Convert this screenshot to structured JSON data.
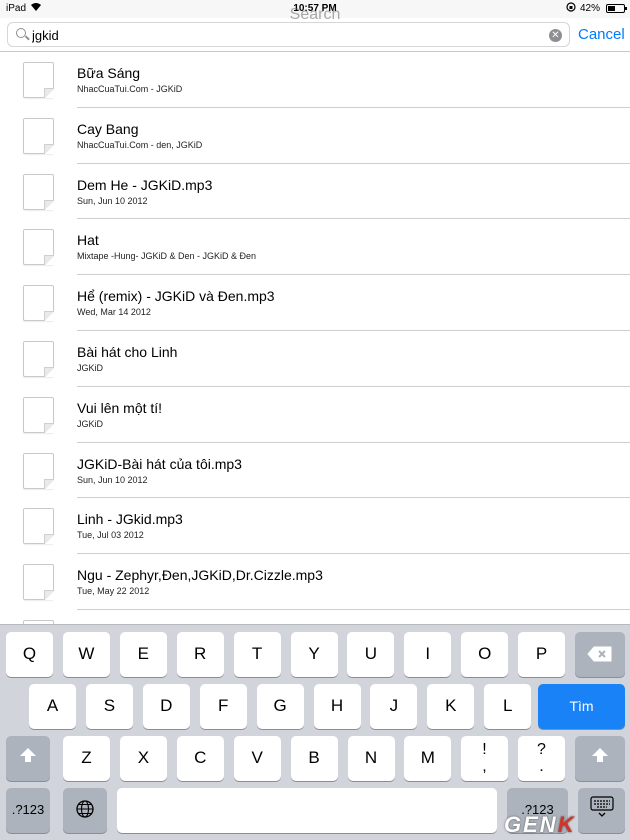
{
  "status_bar": {
    "device": "iPad",
    "time": "10:57 PM",
    "battery": "42%",
    "battery_level": 0.42
  },
  "header": {
    "title": "Search"
  },
  "search": {
    "value": "jgkid",
    "cancel_label": "Cancel"
  },
  "results": [
    {
      "title": "Bữa Sáng",
      "subtitle": "NhacCuaTui.Com - JGKiD"
    },
    {
      "title": "Cay Bang",
      "subtitle": "NhacCuaTui.Com - den, JGKiD"
    },
    {
      "title": "Dem He - JGKiD.mp3",
      "subtitle": "Sun, Jun 10 2012"
    },
    {
      "title": "Hat",
      "subtitle": "Mixtape -Hung- JGKiD & Den - JGKiD & Đen"
    },
    {
      "title": "Hể (remix) - JGKiD và Đen.mp3",
      "subtitle": "Wed, Mar 14 2012"
    },
    {
      "title": "Bài hát cho Linh",
      "subtitle": "JGKiD"
    },
    {
      "title": "Vui lên một tí!",
      "subtitle": "JGKiD"
    },
    {
      "title": "JGKiD-Bài hát của tôi.mp3",
      "subtitle": "Sun, Jun 10 2012"
    },
    {
      "title": "Linh - JGkid.mp3",
      "subtitle": "Tue, Jul 03 2012"
    },
    {
      "title": "Ngu - Zephyr,Đen,JGKiD,Dr.Cizzle.mp3",
      "subtitle": "Tue, May 22 2012"
    },
    {
      "title": "",
      "subtitle": ""
    }
  ],
  "keyboard": {
    "row1": [
      "Q",
      "W",
      "E",
      "R",
      "T",
      "Y",
      "U",
      "I",
      "O",
      "P"
    ],
    "row2": [
      "A",
      "S",
      "D",
      "F",
      "G",
      "H",
      "J",
      "K",
      "L"
    ],
    "row3": [
      "Z",
      "X",
      "C",
      "V",
      "B",
      "N",
      "M"
    ],
    "row3_punct1": "!\n,",
    "row3_punct2": "?\n.",
    "return_label": "Tìm",
    "numbers_label": ".?123",
    "accent_color": "#1a82f7"
  },
  "watermark": {
    "main": "GEN",
    "accent": "K"
  }
}
